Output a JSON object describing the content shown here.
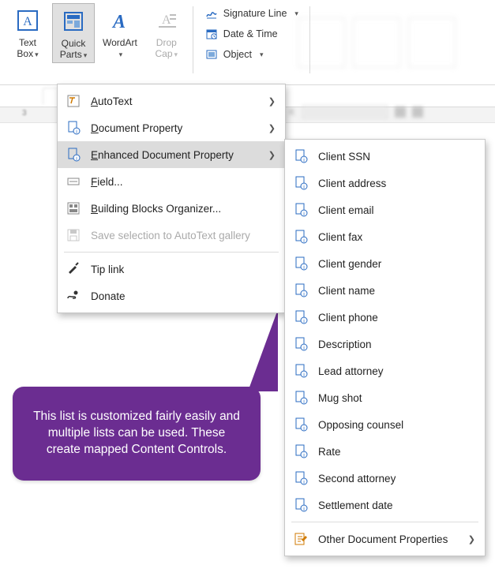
{
  "ribbon": {
    "text_box": {
      "label": "Text\nBox"
    },
    "quick_parts": {
      "label": "Quick\nParts"
    },
    "wordart": {
      "label": "WordArt"
    },
    "drop_cap": {
      "label": "Drop\nCap"
    },
    "signature": {
      "label": "Signature Line"
    },
    "date_time": {
      "label": "Date & Time"
    },
    "object": {
      "label": "Object"
    }
  },
  "ruler": {
    "tick": "3"
  },
  "quick_parts_menu": {
    "autotext": {
      "label": "AutoText",
      "accel": "A"
    },
    "doc_prop": {
      "label": "Document Property",
      "accel": "D"
    },
    "enh_doc_prop": {
      "label": "Enhanced Document Property",
      "accel": "E"
    },
    "field": {
      "label": "Field...",
      "accel": "F"
    },
    "bbo": {
      "label": "Building Blocks Organizer...",
      "accel": "B"
    },
    "save_autotext": {
      "label": "Save selection to AutoText gallery"
    },
    "tip_link": {
      "label": "Tip link"
    },
    "donate": {
      "label": "Donate"
    }
  },
  "enhanced_menu": {
    "items": [
      "Client SSN",
      "Client address",
      "Client email",
      "Client fax",
      "Client gender",
      "Client name",
      "Client phone",
      "Description",
      "Lead attorney",
      "Mug shot",
      "Opposing counsel",
      "Rate",
      "Second attorney",
      "Settlement date"
    ],
    "other": "Other Document Properties"
  },
  "callout": {
    "text": "This list is customized fairly easily and multiple lists can be used. These create mapped Content Controls."
  },
  "colors": {
    "callout": "#6b2d91",
    "menu_highlight": "#dcdcdc"
  }
}
